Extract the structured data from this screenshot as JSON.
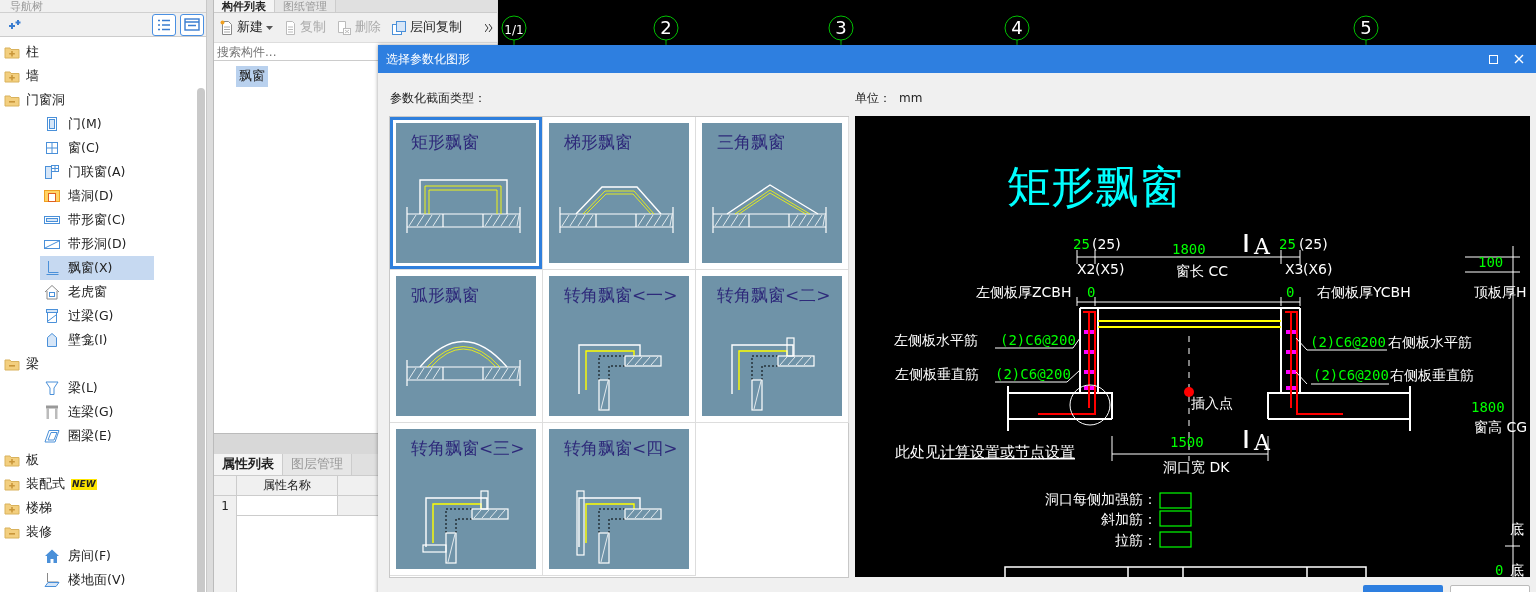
{
  "nav": {
    "title": "导航树",
    "tree": [
      {
        "label": "柱",
        "expanded": false
      },
      {
        "label": "墙",
        "expanded": false
      },
      {
        "label": "门窗洞",
        "expanded": true,
        "children": [
          {
            "label": "门(M)",
            "kind": "door",
            "selected": false
          },
          {
            "label": "窗(C)",
            "kind": "window",
            "selected": false
          },
          {
            "label": "门联窗(A)",
            "kind": "door-window",
            "selected": false
          },
          {
            "label": "墙洞(D)",
            "kind": "wall-opening",
            "selected": false
          },
          {
            "label": "带形窗(C)",
            "kind": "strip-window",
            "selected": false
          },
          {
            "label": "带形洞(D)",
            "kind": "strip-opening",
            "selected": false
          },
          {
            "label": "飘窗(X)",
            "kind": "bay-window",
            "selected": true
          },
          {
            "label": "老虎窗",
            "kind": "dormer",
            "selected": false
          },
          {
            "label": "过梁(G)",
            "kind": "lintel",
            "selected": false
          },
          {
            "label": "壁龛(I)",
            "kind": "niche",
            "selected": false
          }
        ]
      },
      {
        "label": "梁",
        "expanded": true,
        "children": [
          {
            "label": "梁(L)",
            "kind": "beam",
            "selected": false
          },
          {
            "label": "连梁(G)",
            "kind": "coupling-beam",
            "selected": false
          },
          {
            "label": "圈梁(E)",
            "kind": "ring-beam",
            "selected": false
          }
        ]
      },
      {
        "label": "板",
        "expanded": false
      },
      {
        "label": "装配式",
        "expanded": false,
        "badge": "NEW"
      },
      {
        "label": "楼梯",
        "expanded": false
      },
      {
        "label": "装修",
        "expanded": true,
        "children": [
          {
            "label": "房间(F)",
            "kind": "room",
            "selected": false
          },
          {
            "label": "楼地面(V)",
            "kind": "floor",
            "selected": false
          }
        ]
      }
    ]
  },
  "component_panel": {
    "tabs": [
      {
        "label": "构件列表",
        "selected": true
      },
      {
        "label": "图纸管理",
        "selected": false
      }
    ],
    "toolbar": [
      {
        "label": "新建",
        "kind": "new",
        "disabled": false,
        "dropdown": true
      },
      {
        "label": "复制",
        "kind": "copy",
        "disabled": true,
        "dropdown": false
      },
      {
        "label": "删除",
        "kind": "delete",
        "disabled": true,
        "dropdown": false
      },
      {
        "label": "层间复制",
        "kind": "floor-copy",
        "disabled": false,
        "dropdown": false
      }
    ],
    "search": {
      "placeholder": "搜索构件..."
    },
    "items": [
      {
        "label": "飘窗",
        "selected": true
      }
    ],
    "property_tabs": [
      {
        "label": "属性列表",
        "selected": true
      },
      {
        "label": "图层管理",
        "selected": false
      }
    ],
    "property_table": {
      "columns": [
        "属性名称"
      ],
      "rows": [
        {
          "index": "1"
        }
      ]
    }
  },
  "canvas": {
    "axes": [
      "1/1",
      "2",
      "3",
      "4",
      "5"
    ]
  },
  "dialog": {
    "title": "选择参数化图形",
    "section_label": "参数化截面类型：",
    "unit_label": "单位：",
    "unit": "mm",
    "shapes": [
      {
        "label": "矩形飘窗",
        "kind": "rect",
        "selected": true
      },
      {
        "label": "梯形飘窗",
        "kind": "trapezoid",
        "selected": false
      },
      {
        "label": "三角飘窗",
        "kind": "triangle",
        "selected": false
      },
      {
        "label": "弧形飘窗",
        "kind": "arc",
        "selected": false
      },
      {
        "label": "转角飘窗<一>",
        "kind": "corner-1",
        "selected": false
      },
      {
        "label": "转角飘窗<二>",
        "kind": "corner-2",
        "selected": false
      },
      {
        "label": "转角飘窗<三>",
        "kind": "corner-3",
        "selected": false
      },
      {
        "label": "转角飘窗<四>",
        "kind": "corner-4",
        "selected": false
      }
    ],
    "preview": {
      "title": "矩形飘窗",
      "note": "此处见",
      "note_link": "计算设置或节点设置",
      "labels": [
        {
          "text": "25",
          "kind": "dim"
        },
        {
          "text": "(25)",
          "kind": "label"
        },
        {
          "text": "1800",
          "kind": "dim"
        },
        {
          "text": "A",
          "kind": "section"
        },
        {
          "text": "25",
          "kind": "dim"
        },
        {
          "text": "(25)",
          "kind": "label"
        },
        {
          "text": "X2",
          "kind": "label"
        },
        {
          "text": "(X5)",
          "kind": "label"
        },
        {
          "text": "窗长 CC",
          "kind": "label"
        },
        {
          "text": "X3",
          "kind": "label"
        },
        {
          "text": "(X6)",
          "kind": "label"
        },
        {
          "text": "100",
          "kind": "dim"
        },
        {
          "text": "左侧板厚ZCBH",
          "kind": "label"
        },
        {
          "text": "0",
          "kind": "dim"
        },
        {
          "text": "0",
          "kind": "dim"
        },
        {
          "text": "右侧板厚YCBH",
          "kind": "label"
        },
        {
          "text": "顶板厚H",
          "kind": "label"
        },
        {
          "text": "左侧板水平筋",
          "kind": "label"
        },
        {
          "text": "(2)C6@200",
          "kind": "dim"
        },
        {
          "text": "(2)C6@200",
          "kind": "dim"
        },
        {
          "text": "右侧板水平筋",
          "kind": "label"
        },
        {
          "text": "左侧板垂直筋",
          "kind": "label"
        },
        {
          "text": "(2)C6@200",
          "kind": "dim"
        },
        {
          "text": "(2)C6@200",
          "kind": "dim"
        },
        {
          "text": "右侧板垂直筋",
          "kind": "label"
        },
        {
          "text": "插入点",
          "kind": "label"
        },
        {
          "text": "1800",
          "kind": "dim"
        },
        {
          "text": "窗高 CG",
          "kind": "label"
        },
        {
          "text": "1500",
          "kind": "dim"
        },
        {
          "text": "A",
          "kind": "section"
        },
        {
          "text": "洞口宽 DK",
          "kind": "label"
        },
        {
          "text": "洞口每侧加强筋：",
          "kind": "field-label"
        },
        {
          "text": "斜加筋：",
          "kind": "field-label"
        },
        {
          "text": "拉筋：",
          "kind": "field-label"
        },
        {
          "text": "底",
          "kind": "label"
        },
        {
          "text": "0",
          "kind": "dim"
        },
        {
          "text": "底",
          "kind": "label"
        }
      ]
    }
  }
}
